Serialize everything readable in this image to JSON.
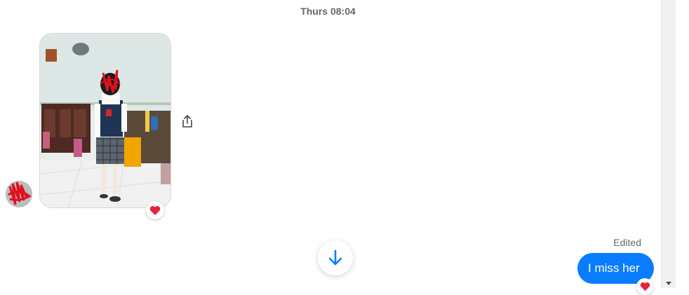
{
  "thread": {
    "timestamp": "Thurs 08:04"
  },
  "incoming_photo": {
    "reaction_icon": "heart-reaction-icon",
    "share_icon": "share-icon"
  },
  "outgoing_message": {
    "edited_label": "Edited",
    "text": "I miss her",
    "reaction_icon": "heart-reaction-icon"
  },
  "colors": {
    "bubble_blue": "#0a7cff",
    "timestamp_gray": "#65676b",
    "heart_red": "#e5243b"
  },
  "controls": {
    "scroll_down_icon": "arrow-down-icon"
  }
}
